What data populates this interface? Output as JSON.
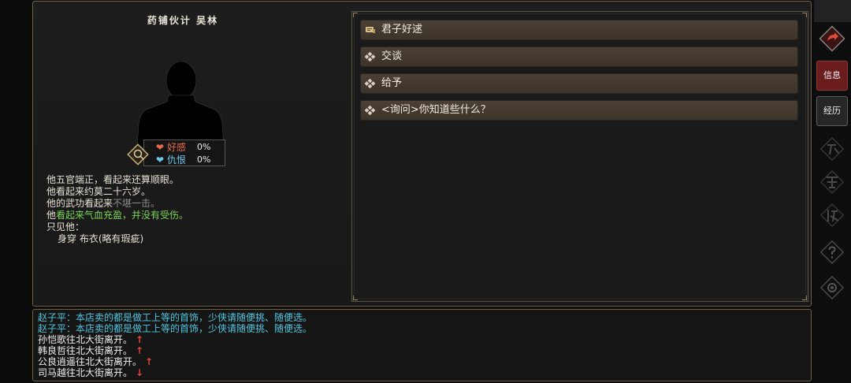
{
  "npc": {
    "title": "药铺伙计 吴林",
    "stats": {
      "love_label": "好感",
      "love_value": "0%",
      "hate_label": "仇恨",
      "hate_value": "0%"
    },
    "description": {
      "line1": "他五官端正，看起来还算顺眼。",
      "line2": "他看起来约莫二十六岁。",
      "line3_prefix": "他的武功看起来",
      "line3_grey": "不堪一击。",
      "line4_prefix": "他",
      "line4_green": "看起来气血充盈，并没有受伤。",
      "line5": "只见他：",
      "line6": "身穿 布衣(略有瑕疵)"
    }
  },
  "options": [
    {
      "label": "君子好逑",
      "icon": "scroll-icon"
    },
    {
      "label": "交谈",
      "icon": "diamond-icon"
    },
    {
      "label": "给予",
      "icon": "diamond-icon"
    },
    {
      "label": "<询问>你知道些什么？",
      "icon": "diamond-icon"
    }
  ],
  "log": [
    {
      "text": "赵子平：本店卖的都是做工上等的首饰，少侠请随便挑、随便选。",
      "color": "#4fc6e0"
    },
    {
      "text": "赵子平：本店卖的都是做工上等的首饰，少侠请随便挑、随便选。",
      "color": "#4fc6e0"
    },
    {
      "text": "孙恺歌往北大街离开。",
      "arrow": "↑"
    },
    {
      "text": "韩良哲往北大街离开。",
      "arrow": "↑"
    },
    {
      "text": "公良逍遥往北大街离开。",
      "arrow": "↑"
    },
    {
      "text": "司马越往北大街离开。",
      "arrow": "↓"
    }
  ],
  "sidebar": {
    "info_label": "信息",
    "exp_label": "经历"
  },
  "colors": {
    "love": "#e86b4c",
    "hate": "#6ec8e8",
    "log_speech": "#4fc6e0",
    "arrow": "#e0453a",
    "info_button": "#6b1d1d"
  }
}
